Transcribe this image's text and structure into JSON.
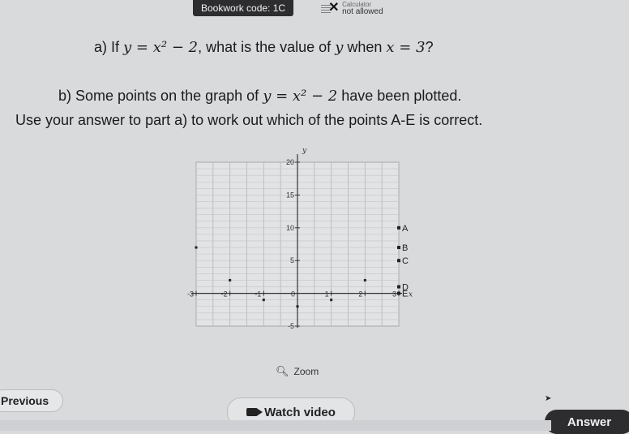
{
  "header": {
    "bookwork_code": "Bookwork code: 1C",
    "calculator_label": "Calculator",
    "calculator_status": "not allowed"
  },
  "question": {
    "part_a_prefix": "a) If",
    "part_a_eq": "y = x² − 2",
    "part_a_mid": ", what is the value of",
    "part_a_var": "y",
    "part_a_when": "when",
    "part_a_cond": "x = 3",
    "part_a_end": "?",
    "part_b_prefix": "b) Some points on the graph of",
    "part_b_eq": "y = x² − 2",
    "part_b_end": "have been plotted.",
    "part_b_line2": "Use your answer to part a) to work out which of the points A-E is correct."
  },
  "chart_data": {
    "type": "scatter",
    "xlabel": "x",
    "ylabel": "y",
    "xlim": [
      -3,
      3
    ],
    "ylim": [
      -5,
      20
    ],
    "x_ticks": [
      "-3",
      "-2",
      "-1",
      "0",
      "1",
      "2",
      "3"
    ],
    "y_ticks": [
      "20",
      "15",
      "10",
      "5",
      "-5"
    ],
    "points_plotted": [
      {
        "x": -3,
        "y": 7
      },
      {
        "x": -2,
        "y": 2
      },
      {
        "x": -1,
        "y": -1
      },
      {
        "x": 0,
        "y": -2
      },
      {
        "x": 1,
        "y": -1
      },
      {
        "x": 2,
        "y": 2
      }
    ],
    "candidate_points": [
      {
        "label": "A",
        "x": 3,
        "y": 10
      },
      {
        "label": "B",
        "x": 3,
        "y": 7
      },
      {
        "label": "C",
        "x": 3,
        "y": 5
      },
      {
        "label": "D",
        "x": 3,
        "y": 1
      },
      {
        "label": "E",
        "x": 3,
        "y": 0
      }
    ]
  },
  "controls": {
    "zoom_label": "Zoom",
    "previous_label": "Previous",
    "watch_video_label": "Watch video",
    "answer_label": "Answer"
  }
}
